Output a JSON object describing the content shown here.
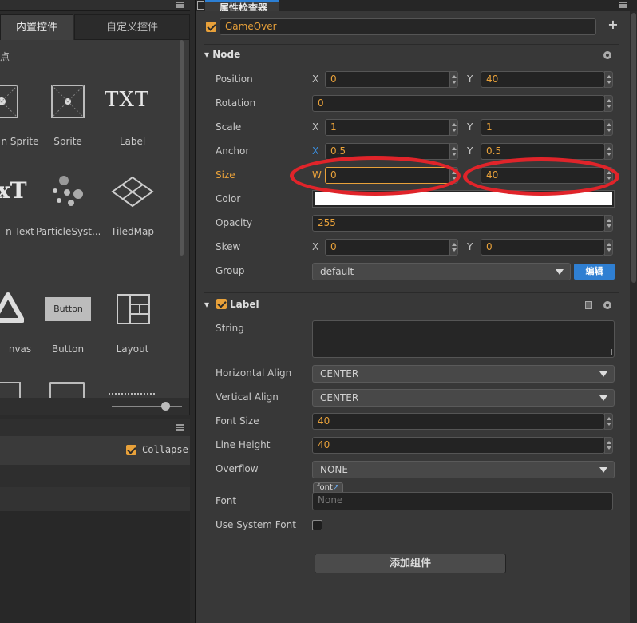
{
  "library": {
    "tabs": [
      "内置控件",
      "自定义控件"
    ],
    "section_label": "点",
    "items": [
      {
        "label": "n Sprite",
        "icon": "sprite-splash-icon"
      },
      {
        "label": "Sprite",
        "icon": "sprite-icon"
      },
      {
        "label": "Label",
        "icon": "label-txt-icon",
        "glyph": "TXT"
      },
      {
        "label": "n Text",
        "icon": "richtext-icon",
        "glyph": "xT"
      },
      {
        "label": "ParticleSyst...",
        "icon": "particle-icon"
      },
      {
        "label": "TiledMap",
        "icon": "tiledmap-icon"
      },
      {
        "label": "nvas",
        "icon": "canvas-icon"
      },
      {
        "label": "Button",
        "icon": "button-icon",
        "glyph": "Button"
      },
      {
        "label": "Layout",
        "icon": "layout-icon"
      }
    ]
  },
  "console": {
    "collapse_label": "Collapse",
    "collapse_checked": true
  },
  "inspector": {
    "tab_title": "属性检查器",
    "node_name": "GameOver",
    "node_active": true,
    "node_section": {
      "title": "Node",
      "props": {
        "position": {
          "label": "Position",
          "x_axis": "X",
          "x": "0",
          "y_axis": "Y",
          "y": "40"
        },
        "rotation": {
          "label": "Rotation",
          "value": "0"
        },
        "scale": {
          "label": "Scale",
          "x_axis": "X",
          "x": "1",
          "y_axis": "Y",
          "y": "1"
        },
        "anchor": {
          "label": "Anchor",
          "x_axis": "X",
          "x": "0.5",
          "y_axis": "Y",
          "y": "0.5"
        },
        "size": {
          "label": "Size",
          "w_axis": "W",
          "w": "0",
          "h": "40"
        },
        "color": {
          "label": "Color",
          "value": "#ffffff"
        },
        "opacity": {
          "label": "Opacity",
          "value": "255"
        },
        "skew": {
          "label": "Skew",
          "x_axis": "X",
          "x": "0",
          "y_axis": "Y",
          "y": "0"
        },
        "group": {
          "label": "Group",
          "value": "default",
          "edit_label": "编辑"
        }
      }
    },
    "label_section": {
      "title": "Label",
      "enabled": true,
      "props": {
        "string": {
          "label": "String",
          "value": ""
        },
        "h_align": {
          "label": "Horizontal Align",
          "value": "CENTER"
        },
        "v_align": {
          "label": "Vertical Align",
          "value": "CENTER"
        },
        "font_size": {
          "label": "Font Size",
          "value": "40"
        },
        "line_height": {
          "label": "Line Height",
          "value": "40"
        },
        "overflow": {
          "label": "Overflow",
          "value": "NONE"
        },
        "font": {
          "label": "Font",
          "tag": "font",
          "placeholder": "None"
        },
        "use_system_font": {
          "label": "Use System Font",
          "checked": false
        }
      }
    },
    "add_component_label": "添加组件"
  },
  "colors": {
    "accent_orange": "#e8a13a",
    "annotation_red": "#e0242a",
    "tab_blue": "#2c7fd4",
    "edit_button_blue": "#2f7fd2"
  }
}
